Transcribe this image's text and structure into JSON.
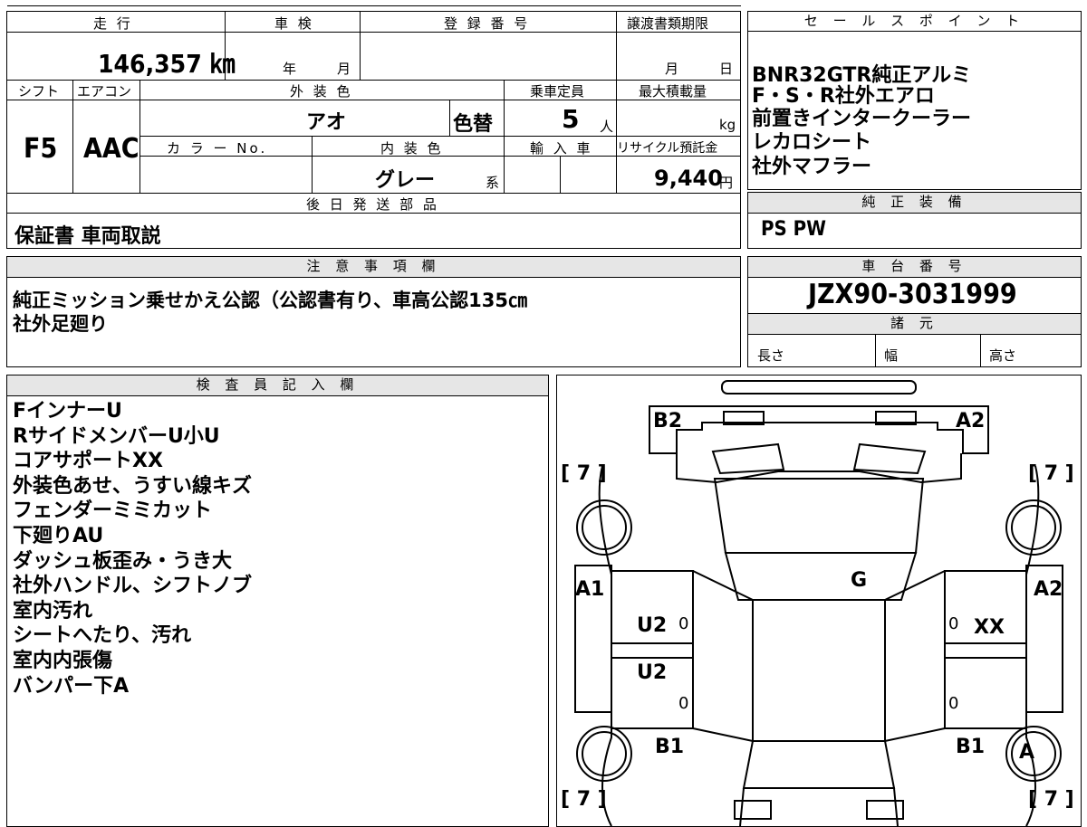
{
  "top_table": {
    "headers": {
      "mileage": "走 行",
      "inspection": "車 検",
      "registration": "登 録 番 号",
      "transfer_deadline": "譲渡書類期限",
      "shift": "シフト",
      "aircon": "エアコン",
      "exterior_color": "外 装 色",
      "capacity": "乗車定員",
      "max_load": "最大積載量",
      "color_no": "カ ラ ー No.",
      "interior_color": "内 装 色",
      "import": "輸 入 車",
      "recycle_fee": "リサイクル預託金",
      "later_parts": "後 日 発 送 部 品"
    },
    "mileage_value": "146,357 ㎞",
    "inspection_year": "年",
    "inspection_month": "月",
    "deadline_month": "月",
    "deadline_day": "日",
    "shift_value": "F5",
    "aircon_value": "AAC",
    "exterior_color_value": "アオ",
    "color_changed": "色替",
    "capacity_value": "5",
    "capacity_unit": "人",
    "max_load_unit": "kg",
    "interior_color_value": "グレー",
    "interior_suffix": "系",
    "recycle_value": "9,440",
    "recycle_unit": "円",
    "later_parts_value": "保証書 車両取説"
  },
  "sales_points": {
    "header": "セ ー ル ス ポ イ ン ト",
    "items": [
      "BNR32GTR純正アルミ",
      "F・S・R社外エアロ",
      "前置きインタークーラー",
      "レカロシート",
      "社外マフラー"
    ]
  },
  "standard_equipment": {
    "header": "純 正 装 備",
    "value": "PS PW"
  },
  "notes": {
    "header": "注 意 事 項 欄",
    "lines": [
      "純正ミッション乗せかえ公認（公認書有り、車高公認135㎝",
      "社外足廻り"
    ]
  },
  "chassis": {
    "header": "車 台 番 号",
    "value": "JZX90-3031999",
    "specs_header": "諸 元",
    "length_label": "長さ",
    "width_label": "幅",
    "height_label": "高さ"
  },
  "inspector": {
    "header": "検 査 員 記 入 欄",
    "lines": [
      "FインナーU",
      "RサイドメンバーU小U",
      "コアサポートXX",
      "外装色あせ、うすい線キズ",
      "フェンダーミミカット",
      "下廻りAU",
      "ダッシュ板歪み・うき大",
      "社外ハンドル、シフトノブ",
      "室内汚れ",
      "シートへたり、汚れ",
      "室内内張傷",
      "バンパー下A"
    ]
  },
  "diagram": {
    "marks": {
      "front_left": "B2",
      "front_right": "A2",
      "fl_tire": "[ 7 ]",
      "fr_tire": "[ 7 ]",
      "rl_tire": "[ 7 ]",
      "rr_tire": "[ 7 ]",
      "left_fender": "A1",
      "right_fender": "A2",
      "glass": "G",
      "left_front_door": "U2",
      "left_rear_door": "U2",
      "right_front_door": "XX",
      "left_rear_quarter": "B1",
      "right_rear_quarter": "B1",
      "right_rear_wheel": "A",
      "door_zero": "0"
    }
  }
}
